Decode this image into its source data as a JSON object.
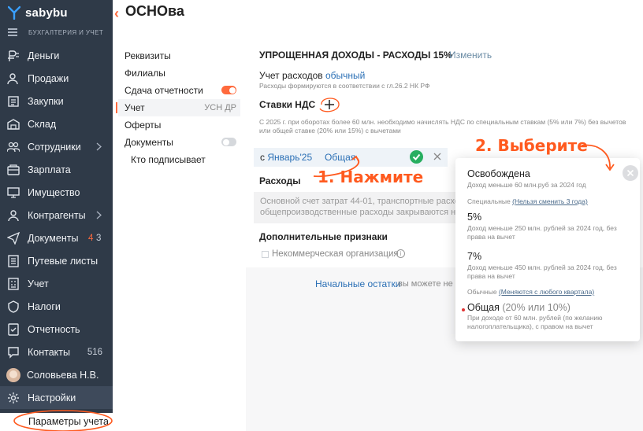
{
  "app": {
    "brand": "sabybu",
    "product": "БУХГАЛТЕРИЯ И УЧЕТ"
  },
  "sidebar": {
    "items": [
      {
        "label": "Деньги",
        "icon": "money-icon"
      },
      {
        "label": "Продажи",
        "icon": "sales-icon"
      },
      {
        "label": "Закупки",
        "icon": "purchases-icon"
      },
      {
        "label": "Склад",
        "icon": "warehouse-icon"
      },
      {
        "label": "Сотрудники",
        "icon": "employees-icon"
      },
      {
        "label": "Зарплата",
        "icon": "salary-icon"
      },
      {
        "label": "Имущество",
        "icon": "property-icon"
      },
      {
        "label": "Контрагенты",
        "icon": "counterparties-icon"
      },
      {
        "label": "Документы",
        "icon": "documents-icon",
        "count_red": "4",
        "count": "3"
      },
      {
        "label": "Путевые листы",
        "icon": "waybills-icon"
      },
      {
        "label": "Учет",
        "icon": "accounting-icon"
      },
      {
        "label": "Налоги",
        "icon": "taxes-icon"
      },
      {
        "label": "Отчетность",
        "icon": "reports-icon"
      },
      {
        "label": "Контакты",
        "icon": "contacts-icon",
        "count": "516"
      },
      {
        "label": "Соловьева Н.В.",
        "icon": "avatar"
      },
      {
        "label": "Настройки",
        "icon": "gear-icon"
      }
    ],
    "sub_item": "Параметры учета"
  },
  "header": {
    "title": "ОСНОва"
  },
  "subnav": {
    "items": [
      {
        "label": "Реквизиты"
      },
      {
        "label": "Филиалы"
      },
      {
        "label": "Сдача отчетности",
        "toggle": "on"
      },
      {
        "label": "Учет",
        "tag": "УСН ДР"
      },
      {
        "label": "Оферты"
      },
      {
        "label": "Документы",
        "toggle": "off"
      },
      {
        "label": "Кто подписывает"
      }
    ]
  },
  "main": {
    "tax_title": "УПРОЩЕННАЯ ДОХОДЫ - РАСХОДЫ 15%",
    "tax_change": "Изменить",
    "acc_prefix": "Учет расходов",
    "acc_value": "обычный",
    "acc_note": "Расходы формируются в соответствии с гл.26.2 НК РФ",
    "vat_title": "Ставки НДС",
    "vat_note_1": "С 2025 г. при оборотах более 60 млн. необходимо начислять НДС по специальным ставкам (5% или 7%) без вычетов",
    "vat_note_2": "или общей ставке (20% или 15%) с вычетами",
    "vat_from_prefix": "с",
    "vat_from_value": "Январь'25",
    "vat_rate": "Общая",
    "expenses_title": "Расходы",
    "expenses_text_1": "Основной счет затрат 44-01, транспортные расходы",
    "expenses_text_2": "общепроизводственные расходы закрываются на",
    "extra_title": "Дополнительные признаки",
    "noncommercial_label": "Некоммерческая организация",
    "init_balances": "Начальные остатки",
    "init_note": "вы можете не"
  },
  "popup": {
    "exempt_title": "Освобождена",
    "exempt_sub": "Доход меньше 60 млн.руб за 2024 год",
    "special_label": "Специальные",
    "special_link": "(Нельзя сменить 3 года)",
    "rate5_title": "5%",
    "rate5_sub_1": "Доход меньше 250 млн. рублей за 2024 год, без",
    "rate5_sub_2": "права на вычет",
    "rate7_title": "7%",
    "rate7_sub_1": "Доход меньше 450 млн. рублей за 2024 год, без",
    "rate7_sub_2": "права на вычет",
    "normal_label": "Обычные",
    "normal_link": "(Меняются с любого квартала)",
    "general_title": "Общая",
    "general_suffix": "(20% или 10%)",
    "general_sub_1": "При доходе от 60 млн. рублей (по желанию",
    "general_sub_2": "налогоплательщика), с правом на вычет"
  },
  "annotations": {
    "step1": "1. Нажмите",
    "step2": "2. Выберите"
  },
  "colors": {
    "sidebar_bg": "#2f3a48",
    "accent": "#ff6a3d",
    "link": "#2a6fb5",
    "success": "#27ae60"
  }
}
